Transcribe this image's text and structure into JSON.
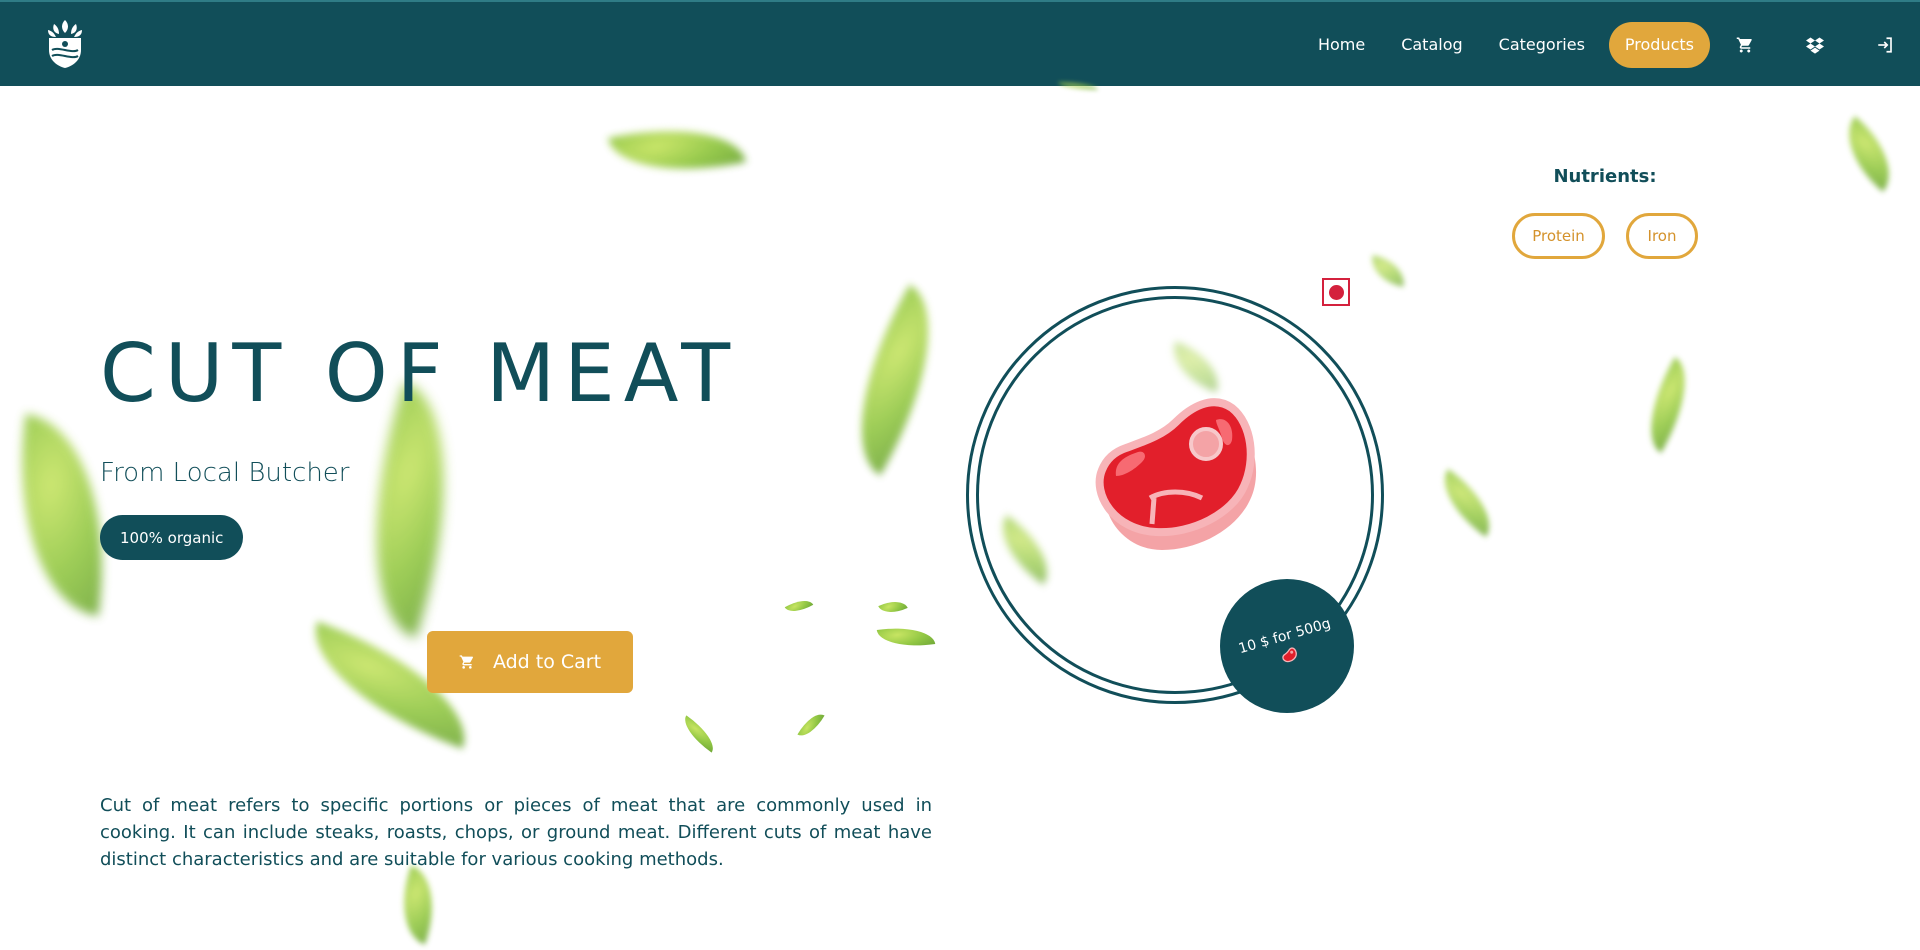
{
  "nav": {
    "links": [
      "Home",
      "Catalog",
      "Categories"
    ],
    "active_link": "Products",
    "icons": [
      "cart-icon",
      "dropbox-icon",
      "login-icon"
    ]
  },
  "hero": {
    "title": "CUT OF MEAT",
    "subtitle": "From Local Butcher",
    "badge": "100% organic",
    "add_to_cart": "Add to Cart",
    "description": "Cut of meat refers to specific portions or pieces of meat that are commonly used in cooking. It can include steaks, roasts, chops, or ground meat. Different cuts of meat have distinct characteristics and are suitable for various cooking methods."
  },
  "nutrients": {
    "title": "Nutrients:",
    "items": [
      "Protein",
      "Iron"
    ]
  },
  "product": {
    "price": "10 $ for 500g",
    "image": "steak-icon"
  },
  "colors": {
    "primary": "#114e59",
    "accent": "#e1a73c",
    "marker": "#d4213d"
  }
}
